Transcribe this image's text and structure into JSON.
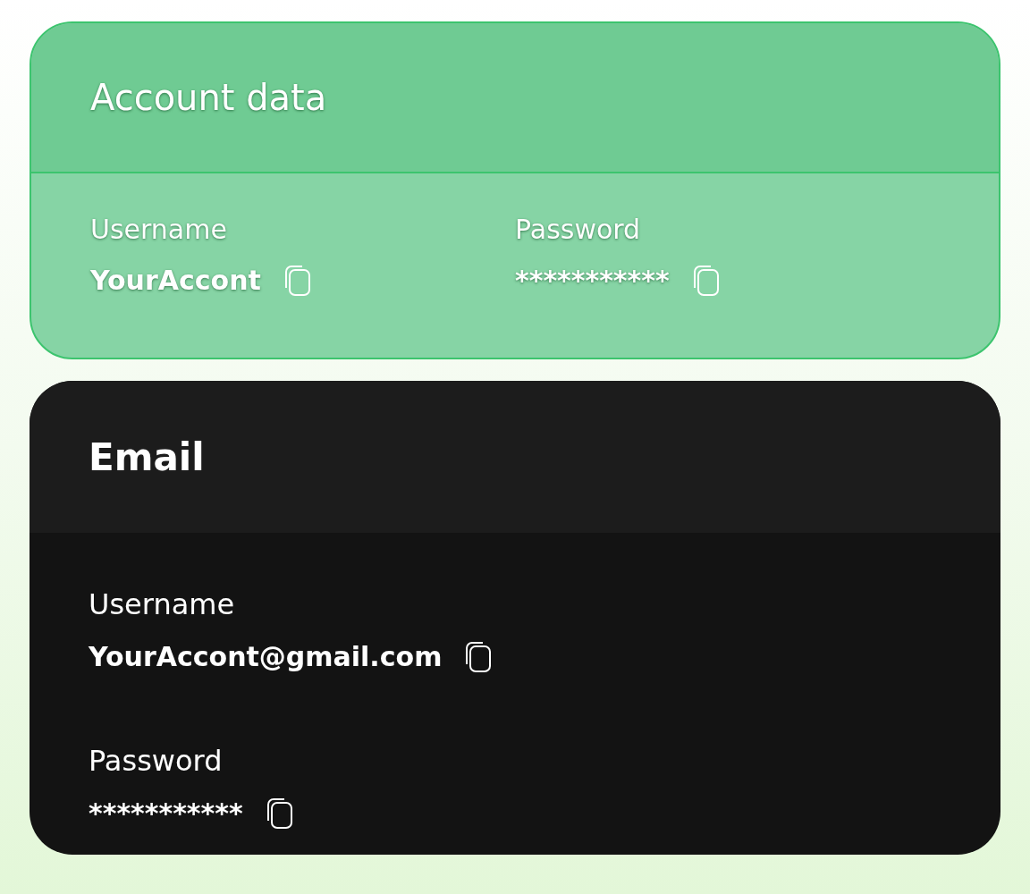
{
  "cards": [
    {
      "kind": "light",
      "title": "Account data",
      "fields": [
        {
          "label": "Username",
          "value": "YourAccont"
        },
        {
          "label": "Password",
          "value": "***********"
        }
      ]
    },
    {
      "kind": "dark",
      "title": "Email",
      "fields": [
        {
          "label": "Username",
          "value": "YourAccont@gmail.com"
        },
        {
          "label": "Password",
          "value": "***********"
        }
      ]
    }
  ]
}
